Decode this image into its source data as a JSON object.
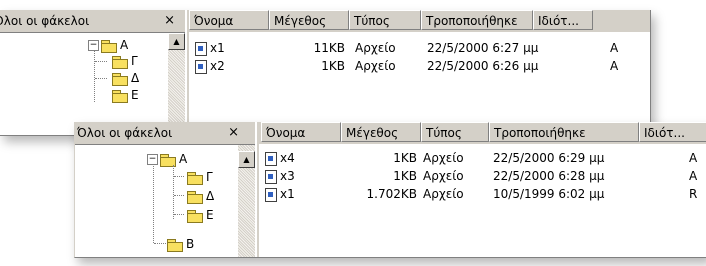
{
  "window1": {
    "panel_title": "Όλοι οι φάκελοι",
    "close_glyph": "×",
    "tree": [
      {
        "label": "Α",
        "expander": "⊟"
      },
      {
        "label": "Γ"
      },
      {
        "label": "Δ"
      },
      {
        "label": "Ε"
      }
    ],
    "columns": [
      "Όνομα",
      "Μέγεθος",
      "Τύπος",
      "Τροποποιήθηκε",
      "Ιδιότ..."
    ],
    "rows": [
      {
        "name": "x1",
        "size": "11KB",
        "type": "Αρχείο",
        "modified": "22/5/2000 6:27 μμ",
        "attr": "A"
      },
      {
        "name": "x2",
        "size": "1KB",
        "type": "Αρχείο",
        "modified": "22/5/2000 6:26 μμ",
        "attr": "A"
      }
    ]
  },
  "window2": {
    "panel_title": "Όλοι οι φάκελοι",
    "close_glyph": "×",
    "tree": [
      {
        "label": "Α",
        "expander": "⊟"
      },
      {
        "label": "Γ"
      },
      {
        "label": "Δ"
      },
      {
        "label": "Ε"
      },
      {
        "label": "Β"
      }
    ],
    "columns": [
      "Όνομα",
      "Μέγεθος",
      "Τύπος",
      "Τροποποιήθηκε",
      "Ιδιότ..."
    ],
    "rows": [
      {
        "name": "x4",
        "size": "1KB",
        "type": "Αρχείο",
        "modified": "22/5/2000 6:29 μμ",
        "attr": "A"
      },
      {
        "name": "x3",
        "size": "1KB",
        "type": "Αρχείο",
        "modified": "22/5/2000 6:28 μμ",
        "attr": "A"
      },
      {
        "name": "x1",
        "size": "1.702KB",
        "type": "Αρχείο",
        "modified": "10/5/1999 6:02 μμ",
        "attr": "R"
      }
    ]
  },
  "icons": {
    "folder": "folder-icon",
    "file": "file-icon",
    "scroll_up": "scroll-up-icon"
  }
}
